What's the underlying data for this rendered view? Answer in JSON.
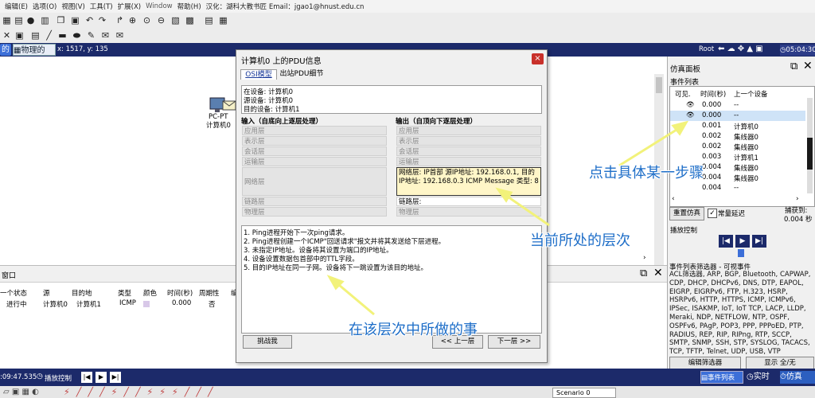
{
  "menubar": {
    "edit": "编辑(E)",
    "options": "选项(O)",
    "view": "视图(V)",
    "tools": "工具(T)",
    "extensions": "扩展(X)",
    "window": "Window",
    "help": "帮助(H)",
    "credit": "汉化：湖科大教书匠 Email：jgao1@hnust.edu.cn"
  },
  "topbar": {
    "logical_tab": "的",
    "physical_tab": "物理的",
    "coords": "x: 1517, y: 135",
    "root": "Root",
    "clock": "05:04:30"
  },
  "canvas": {
    "device_line1": "PC-PT",
    "device_line2": "计算机0",
    "annotation_step": "点击具体某一步骤",
    "annotation_layer": "当前所处的层次",
    "annotation_action": "在该层次中所做的事"
  },
  "dialog": {
    "title": "计算机0 上的PDU信息",
    "close": "×",
    "tabs": [
      "OSI模型",
      "出站PDU细节"
    ],
    "info": [
      "在设备: 计算机0",
      "源设备: 计算机0",
      "目的设备: 计算机1"
    ],
    "in_header": "输入（自底向上逐层处理）",
    "out_header": "输出（自顶向下逐层处理）",
    "in_layers": [
      "应用层",
      "表示层",
      "会话层",
      "运输层",
      "网络层",
      "链路层",
      "物理层"
    ],
    "out_layers": [
      "应用层",
      "表示层",
      "会话层",
      "运输层"
    ],
    "out_network": "网络层: IP首部 源IP地址: 192.168.0.1, 目的IP地址: 192.168.0.3 ICMP Message 类型: 8",
    "out_link": "链路层:",
    "out_physical": "物理层",
    "steps": [
      "1. Ping进程开始下一次ping请求。",
      "2. Ping进程创建一个ICMP\"回送请求\"报文并将其发送给下层进程。",
      "3. 未指定IP地址。设备将其设置为端口的IP地址。",
      "4. 设备设置数据包首部中的TTL字段。",
      "5. 目的IP地址在同一子网。设备将下一跳设置为该目的地址。"
    ],
    "challenge_btn": "挑战我",
    "prev_btn": "<< 上一层",
    "next_btn": "下一层 >>"
  },
  "pdu_window": {
    "title": "窗口",
    "headers": [
      "一个状态",
      "源",
      "目的地",
      "类型",
      "颜色",
      "时间(秒)",
      "周期性",
      "编"
    ],
    "row": [
      "进行中",
      "计算机0",
      "计算机1",
      "ICMP",
      "",
      "0.000",
      "否",
      ""
    ]
  },
  "sim_panel": {
    "title": "仿真面板",
    "event_list": "事件列表",
    "headers": [
      "可见.",
      "时间(秒)",
      "上一个设备"
    ],
    "events": [
      {
        "time": "0.000",
        "device": "--"
      },
      {
        "time": "0.000",
        "device": "--"
      },
      {
        "time": "0.001",
        "device": "计算机0"
      },
      {
        "time": "0.002",
        "device": "集线器0"
      },
      {
        "time": "0.002",
        "device": "集线器0"
      },
      {
        "time": "0.003",
        "device": "计算机1"
      },
      {
        "time": "0.004",
        "device": "集线器0"
      },
      {
        "time": "0.004",
        "device": "集线器0"
      },
      {
        "time": "0.004",
        "device": "--"
      }
    ],
    "reset_btn": "重置仿真",
    "const_delay": "常量延迟",
    "captured_label": "捕获到:",
    "captured_value": "0.004 秒",
    "playback": "播放控制",
    "filter_title": "事件列表筛选器 - 可视事件",
    "filter_text": "ACL筛选器, ARP, BGP, Bluetooth, CAPWAP, CDP, DHCP, DHCPv6, DNS, DTP, EAPOL, EIGRP, EIGRPv6, FTP, H.323, HSRP, HSRPv6, HTTP, HTTPS, ICMP, ICMPv6, IPSec, ISAKMP, IoT, IoT TCP, LACP, LLDP, Meraki, NDP, NETFLOW, NTP, OSPF, OSPFv6, PAgP, POP3, PPP, PPPoED, PTP, RADIUS, REP, RIP, RIPng, RTP, SCCP, SMTP, SNMP, SSH, STP, SYSLOG, TACACS, TCP, TFTP, Telnet, UDP, USB, VTP",
    "edit_filter_btn": "编辑筛选器",
    "show_all_btn": "显示 全/无"
  },
  "bottom": {
    "time": ":09:47.535",
    "playback": "播放控制",
    "event_list_btn": "事件列表",
    "realtime_btn": "实时",
    "sim_btn": "仿真",
    "scenario": "Scenario 0"
  },
  "colors": {
    "accent": "#1e6ec8",
    "navbar": "#1c2a6a",
    "highlight": "#fff6c8",
    "arrow": "#f2f27a"
  }
}
